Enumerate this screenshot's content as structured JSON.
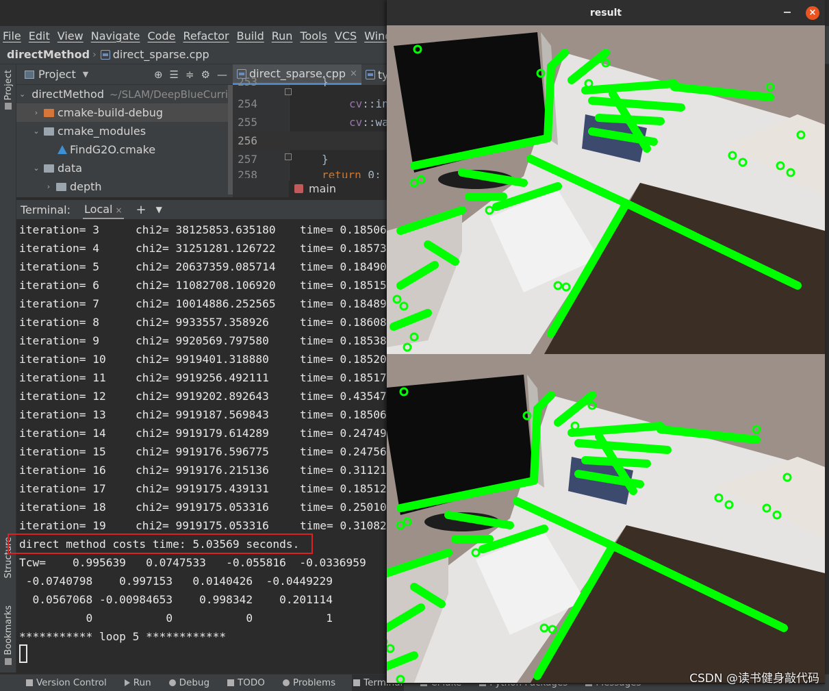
{
  "menu": [
    "File",
    "Edit",
    "View",
    "Navigate",
    "Code",
    "Refactor",
    "Build",
    "Run",
    "Tools",
    "VCS",
    "Window"
  ],
  "breadcrumb": {
    "project": "directMethod",
    "file": "direct_sparse.cpp"
  },
  "left_strip": {
    "project_tab": "Project",
    "structure_tab": "Structure",
    "bookmarks_tab": "Bookmarks"
  },
  "project_panel": {
    "title": "Project",
    "tree": [
      {
        "label": "directMethod",
        "path": "~/SLAM/DeepBlueCurric",
        "expanded": true
      },
      {
        "label": "cmake-build-debug",
        "expanded": false
      },
      {
        "label": "cmake_modules",
        "expanded": true
      },
      {
        "label": "FindG2O.cmake"
      },
      {
        "label": "data",
        "expanded": true
      },
      {
        "label": "depth",
        "expanded": false
      }
    ]
  },
  "editor": {
    "tabs": [
      {
        "label": "direct_sparse.cpp",
        "active": true
      },
      {
        "label": "typ",
        "active": false
      }
    ],
    "lines": [
      {
        "num": "253",
        "code": "}"
      },
      {
        "num": "254",
        "ns": "cv",
        "rest": "::in"
      },
      {
        "num": "255",
        "ns": "cv",
        "rest": "::wa"
      },
      {
        "num": "256",
        "code": ""
      },
      {
        "num": "257",
        "code": "}"
      },
      {
        "num": "258",
        "kw": "return",
        "rest": " 0;"
      }
    ],
    "function_crumb": "main"
  },
  "terminal": {
    "label": "Terminal:",
    "tab": "Local",
    "iterations": [
      {
        "it": "3",
        "chi2": "38125853.635180",
        "time": "0.18506"
      },
      {
        "it": "4",
        "chi2": "31251281.126722",
        "time": "0.18573"
      },
      {
        "it": "5",
        "chi2": "20637359.085714",
        "time": "0.18490"
      },
      {
        "it": "6",
        "chi2": "11082708.106920",
        "time": "0.18515"
      },
      {
        "it": "7",
        "chi2": "10014886.252565",
        "time": "0.18489"
      },
      {
        "it": "8",
        "chi2": "9933557.358926",
        "time": "0.18608"
      },
      {
        "it": "9",
        "chi2": "9920569.797580",
        "time": "0.18538"
      },
      {
        "it": "10",
        "chi2": "9919401.318880",
        "time": "0.18520"
      },
      {
        "it": "11",
        "chi2": "9919256.492111",
        "time": "0.18517"
      },
      {
        "it": "12",
        "chi2": "9919202.892643",
        "time": "0.43547"
      },
      {
        "it": "13",
        "chi2": "9919187.569843",
        "time": "0.18506"
      },
      {
        "it": "14",
        "chi2": "9919179.614289",
        "time": "0.24749"
      },
      {
        "it": "15",
        "chi2": "9919176.596775",
        "time": "0.24756"
      },
      {
        "it": "16",
        "chi2": "9919176.215136",
        "time": "0.31121"
      },
      {
        "it": "17",
        "chi2": "9919175.439131",
        "time": "0.18512"
      },
      {
        "it": "18",
        "chi2": "9919175.053316",
        "time": "0.25010"
      },
      {
        "it": "19",
        "chi2": "9919175.053316",
        "time": "0.31082"
      }
    ],
    "summary": "direct method costs time: 5.03569 seconds.",
    "tcw": [
      "Tcw=    0.995639   0.0747533   -0.055816  -0.0336959",
      " -0.0740798    0.997153   0.0140426  -0.0449229",
      "  0.0567068 -0.00984653    0.998342    0.201114",
      "          0           0           0           1"
    ],
    "loop": "*********** loop 5 ************"
  },
  "statusbar": [
    "Version Control",
    "Run",
    "Debug",
    "TODO",
    "Problems",
    "Terminal",
    "CMake",
    "Python Packages",
    "Messages"
  ],
  "result_window": {
    "title": "result",
    "close_glyph": "×"
  },
  "watermark": "CSDN @读书健身敲代码",
  "colors": {
    "accent_tab": "#4a88c7",
    "highlight_box": "#e02020",
    "tracked_points": "#00ff00",
    "close_button": "#e95420"
  }
}
